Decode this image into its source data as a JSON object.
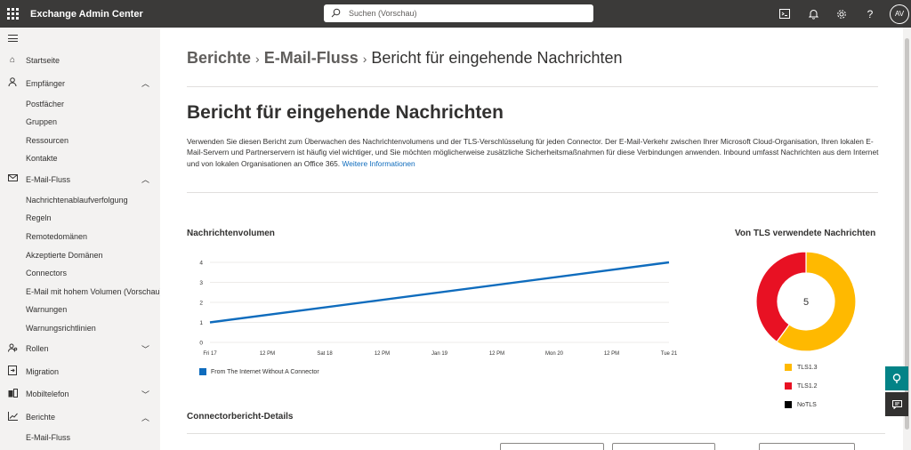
{
  "app": {
    "title": "Exchange Admin Center"
  },
  "search": {
    "placeholder": "Suchen (Vorschau)"
  },
  "header_icons": [
    "terminal-icon",
    "bell-icon",
    "gear-icon",
    "help-icon"
  ],
  "user": {
    "initials": "AV"
  },
  "sidebar": {
    "items": [
      {
        "label": "Startseite",
        "icon": "home-icon"
      },
      {
        "label": "Empfänger",
        "icon": "person-icon",
        "expanded": true,
        "children": [
          "Postfächer",
          "Gruppen",
          "Ressourcen",
          "Kontakte"
        ]
      },
      {
        "label": "E-Mail-Fluss",
        "icon": "mail-icon",
        "expanded": true,
        "children": [
          "Nachrichtenablaufverfolgung",
          "Regeln",
          "Remotedomänen",
          "Akzeptierte Domänen",
          "Connectors",
          "E-Mail mit hohem Volumen (Vorschau)",
          "Warnungen",
          "Warnungsrichtlinien"
        ]
      },
      {
        "label": "Rollen",
        "icon": "roles-icon",
        "expanded": false
      },
      {
        "label": "Migration",
        "icon": "migration-icon"
      },
      {
        "label": "Mobiltelefon",
        "icon": "mobile-icon",
        "expanded": false
      },
      {
        "label": "Berichte",
        "icon": "reports-icon",
        "expanded": true,
        "children": [
          "E-Mail-Fluss"
        ]
      }
    ]
  },
  "breadcrumb": {
    "items": [
      "Berichte",
      "E-Mail-Fluss"
    ],
    "current": "Bericht für eingehende Nachrichten"
  },
  "page": {
    "title": "Bericht für eingehende Nachrichten",
    "description": "Verwenden Sie diesen Bericht zum Überwachen des Nachrichtenvolumens und der TLS-Verschlüsselung für jeden Connector. Der E-Mail-Verkehr zwischen Ihrer Microsoft Cloud-Organisation, Ihren lokalen E-Mail-Servern und Partnerservern ist häufig viel wichtiger, und Sie möchten möglicherweise zusätzliche Sicherheitsmaßnahmen für diese Verbindungen anwenden. Inbound umfasst Nachrichten aus dem Internet und von lokalen Organisationen an Office 365.",
    "link": "Weitere Informationen"
  },
  "sections": {
    "volume": "Nachrichtenvolumen",
    "tls": "Von TLS verwendete Nachrichten",
    "connector": "Connectorbericht-Details"
  },
  "chart_data": [
    {
      "type": "line",
      "title": "Nachrichtenvolumen",
      "x_ticks": [
        "Fri 17",
        "12 PM",
        "Sat 18",
        "12 PM",
        "Jan 19",
        "12 PM",
        "Mon 20",
        "12 PM",
        "Tue 21"
      ],
      "y_ticks": [
        "0",
        "1",
        "2",
        "3",
        "4"
      ],
      "ylim": [
        0,
        4
      ],
      "grid": true,
      "series": [
        {
          "name": "From The Internet Without A Connector",
          "color": "#0f6cbd",
          "x": [
            "Fri 17",
            "Tue 21"
          ],
          "values": [
            1,
            4
          ]
        }
      ],
      "legend": "bottom-left"
    },
    {
      "type": "pie",
      "title": "Von TLS verwendete Nachrichten",
      "center_label": "5",
      "labels": [
        "TLS1.3",
        "TLS1.2",
        "NoTLS"
      ],
      "values": [
        3,
        2,
        0
      ],
      "colors": [
        "#ffb900",
        "#e81123",
        "#000000"
      ],
      "legend": "bottom"
    }
  ],
  "floating": [
    "feedback-icon",
    "chat-icon"
  ],
  "colors": {
    "topbar": "#3b3a39",
    "accent": "#0f6cbd",
    "teal": "#038387"
  }
}
